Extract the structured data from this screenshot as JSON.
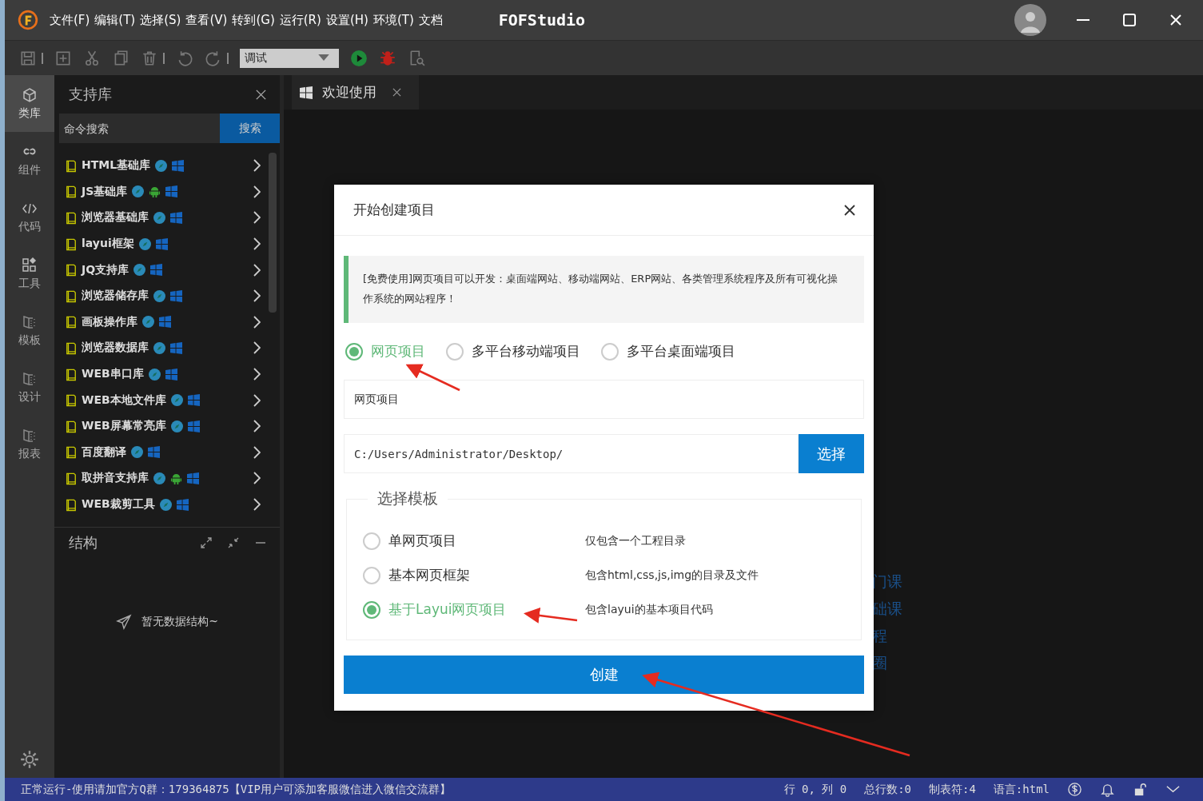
{
  "window": {
    "menu": [
      "文件(F)",
      "编辑(T)",
      "选择(S)",
      "查看(V)",
      "转到(G)",
      "运行(R)",
      "设置(H)",
      "环境(T)",
      "文档"
    ],
    "title": "FOFStudio"
  },
  "toolbar": {
    "mode_select": "调试"
  },
  "activity_bar": [
    {
      "label": "类库",
      "kind": "cube",
      "selected": true
    },
    {
      "label": "组件",
      "kind": "link",
      "selected": false
    },
    {
      "label": "代码",
      "kind": "code",
      "selected": false
    },
    {
      "label": "工具",
      "kind": "grid",
      "selected": false
    },
    {
      "label": "模板",
      "kind": "doc",
      "selected": false
    },
    {
      "label": "设计",
      "kind": "doc",
      "selected": false
    },
    {
      "label": "报表",
      "kind": "doc",
      "selected": false
    }
  ],
  "sidebar": {
    "title": "支持库",
    "search": {
      "placeholder": "命令搜索",
      "button": "搜索"
    },
    "items": [
      {
        "name": "HTML基础库",
        "android": false
      },
      {
        "name": "JS基础库",
        "android": true
      },
      {
        "name": "浏览器基础库",
        "android": false
      },
      {
        "name": "layui框架",
        "android": false
      },
      {
        "name": "JQ支持库",
        "android": false
      },
      {
        "name": "浏览器储存库",
        "android": false
      },
      {
        "name": "画板操作库",
        "android": false
      },
      {
        "name": "浏览器数据库",
        "android": false
      },
      {
        "name": "WEB串口库",
        "android": false
      },
      {
        "name": "WEB本地文件库",
        "android": false
      },
      {
        "name": "WEB屏幕常亮库",
        "android": false
      },
      {
        "name": "百度翻译",
        "android": false
      },
      {
        "name": "取拼音支持库",
        "android": true
      },
      {
        "name": "WEB裁剪工具",
        "android": false
      }
    ]
  },
  "structure": {
    "title": "结构",
    "empty": "暂无数据结构~"
  },
  "editor": {
    "tabs": [
      {
        "label": "欢迎使用",
        "selected": true
      }
    ],
    "background_links": [
      "门课",
      "础课",
      "程",
      "圈"
    ]
  },
  "dialog": {
    "title": "开始创建项目",
    "notice": "[免费使用]网页项目可以开发：桌面端网站、移动端网站、ERP网站、各类管理系统程序及所有可视化操作系统的网站程序！",
    "project_types": [
      {
        "label": "网页项目",
        "selected": true
      },
      {
        "label": "多平台移动端项目",
        "selected": false
      },
      {
        "label": "多平台桌面端项目",
        "selected": false
      }
    ],
    "name_field": {
      "value": "网页项目"
    },
    "path_field": {
      "value": "C:/Users/Administrator/Desktop/",
      "button": "选择"
    },
    "template_group": {
      "legend": "选择模板",
      "templates": [
        {
          "label": "单网页项目",
          "description": "仅包含一个工程目录",
          "selected": false
        },
        {
          "label": "基本网页框架",
          "description": "包含html,css,js,img的目录及文件",
          "selected": false
        },
        {
          "label": "基于Layui网页项目",
          "description": "包含layui的基本项目代码",
          "selected": true
        }
      ]
    },
    "create_button": "创建"
  },
  "status_bar": {
    "message": "正常运行-使用请加官方Q群：179364875【VIP用户可添加客服微信进入微信交流群】",
    "items": [
      "行 0, 列 0",
      "总行数:0",
      "制表符:4",
      "语言:html"
    ]
  }
}
